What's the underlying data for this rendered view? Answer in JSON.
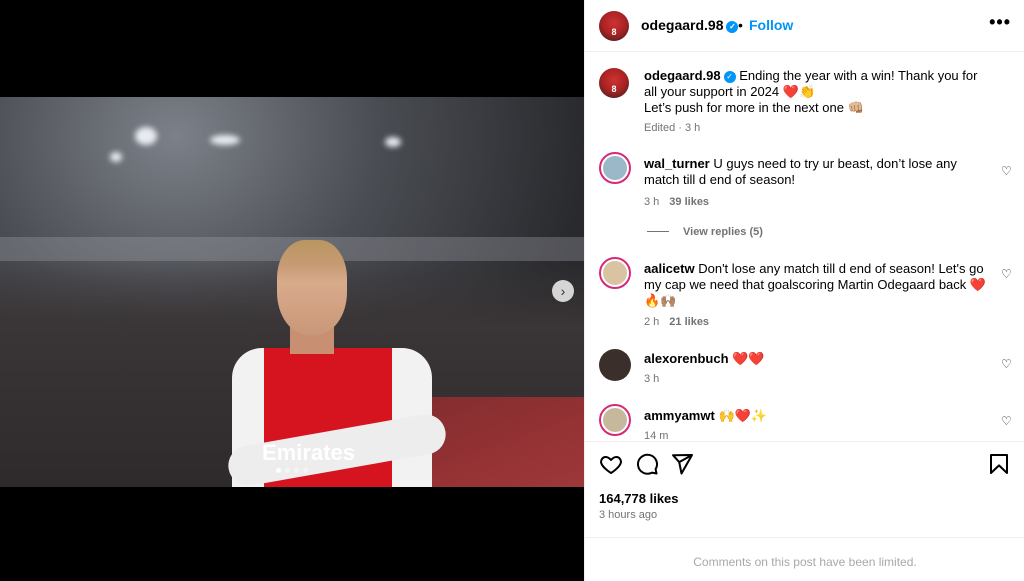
{
  "post": {
    "username": "odegaard.98",
    "follow_label": "Follow",
    "separator": "•",
    "more": "•••",
    "avatar_number": "8"
  },
  "caption": {
    "username": "odegaard.98",
    "text": "Ending the year with a win! Thank you for all your support in 2024 ❤️👏",
    "text2": "Let’s push for more in the next one 👊🏼",
    "meta": "Edited · 3 h"
  },
  "comments": [
    {
      "username": "wal_turner",
      "text": "U guys need to try ur beast, don’t lose any match till d end of season!",
      "time": "3 h",
      "likes": "39 likes"
    },
    {
      "username": "aalicetw",
      "text": "Don't lose any match till d end of season! Let's go my cap we need that goalscoring Martin Odegaard back ❤️🔥🙌🏽",
      "time": "2 h",
      "likes": "21 likes"
    },
    {
      "username": "alexorenbuch",
      "text": "❤️❤️",
      "time": "3 h",
      "likes": ""
    },
    {
      "username": "ammyamwt",
      "text": "🙌❤️✨",
      "time": "14 m",
      "likes": ""
    }
  ],
  "view_replies": "View replies (5)",
  "actions": {
    "likes": "164,778 likes",
    "time_ago": "3 hours ago"
  },
  "footer_text": "Comments on this post have been limited.",
  "carousel": {
    "total": 4,
    "active": 1
  },
  "photo_text": {
    "sponsor": "Emirates"
  },
  "colors": {
    "accent": "#0095f6",
    "meta": "#737373"
  }
}
